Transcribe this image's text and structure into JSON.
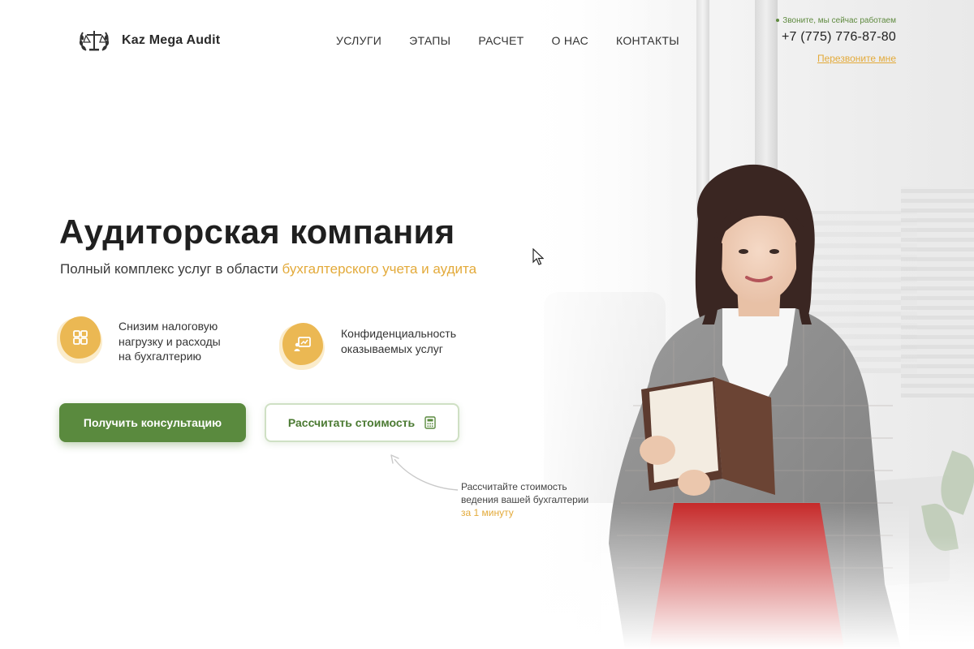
{
  "header": {
    "logo_text": "Kaz Mega Audit",
    "logo_icon": "scales-laurel-icon",
    "nav": [
      {
        "label": "УСЛУГИ"
      },
      {
        "label": "ЭТАПЫ"
      },
      {
        "label": "РАСЧЕТ"
      },
      {
        "label": "О НАС"
      },
      {
        "label": "КОНТАКТЫ"
      }
    ],
    "contact": {
      "status": "Звоните, мы сейчас работаем",
      "phone": "+7 (775) 776-87-80",
      "callback": "Перезвоните мне"
    }
  },
  "hero": {
    "title": "Аудиторская компания",
    "subtitle_plain": "Полный комплекс услуг в области ",
    "subtitle_accent": "бухгалтерского учета и аудита",
    "features": [
      {
        "icon": "grid-icon",
        "lines": [
          "Снизим налоговую",
          "нагрузку и расходы",
          "на бухгалтерию"
        ]
      },
      {
        "icon": "presentation-icon",
        "lines": [
          "Конфиденциальность",
          "оказываемых услуг"
        ]
      }
    ],
    "buttons": {
      "primary": "Получить консультацию",
      "secondary": "Рассчитать стоимость",
      "secondary_icon": "calculator-icon"
    },
    "note": {
      "lines": [
        "Рассчитайте стоимость",
        "ведения вашей бухгалтерии"
      ],
      "accent": "за 1 минуту"
    }
  },
  "colors": {
    "green": "#5a8a3e",
    "accent": "#e3aa3a",
    "text": "#1f1f1f"
  }
}
